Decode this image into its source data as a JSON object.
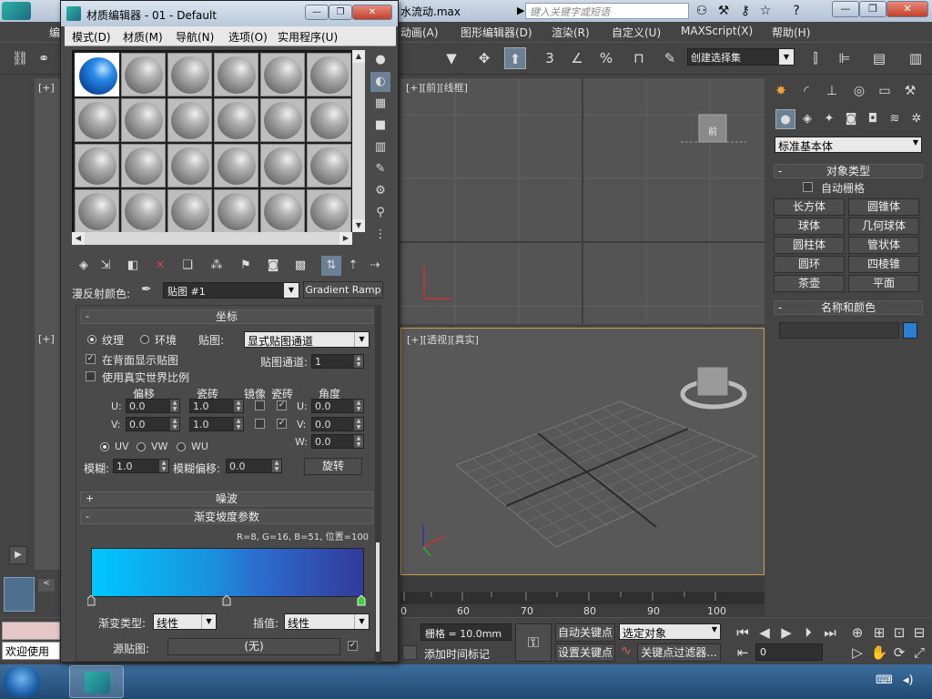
{
  "app": {
    "window_title": "水流动.max",
    "search_placeholder": "键入关键字或短语",
    "menus": [
      "编",
      "动画(A)",
      "图形编辑器(D)",
      "渲染(R)",
      "自定义(U)",
      "MAXScript(X)",
      "帮助(H)"
    ],
    "selection_set": "创建选择集",
    "viewports": {
      "top_label": "[+][前][线框]",
      "persp_label": "[+][透视][真实]",
      "left_top_label": "[+]",
      "left_bottom_label": "[+]"
    },
    "command_panel": {
      "category": "标准基本体",
      "object_type_header": "对象类型",
      "autogrid_label": "自动栅格",
      "buttons": [
        "长方体",
        "圆锥体",
        "球体",
        "几何球体",
        "圆柱体",
        "管状体",
        "圆环",
        "四棱锥",
        "茶壶",
        "平面"
      ],
      "name_color_header": "名称和颜色",
      "object_color": "#2a7fd4"
    },
    "timeline": {
      "ticks": [
        "60",
        "70",
        "80",
        "90",
        "100"
      ],
      "first_tick": "0"
    },
    "statusbar": {
      "welcome": "欢迎使用",
      "grid": "栅格 = 10.0mm",
      "add_time_tag": "添加时间标记",
      "auto_key": "自动关键点",
      "set_key": "设置关键点",
      "selected_objects": "选定对象",
      "key_filters": "关键点过滤器...",
      "frame_value": "0"
    },
    "view_cube_label": "前"
  },
  "material_editor": {
    "title": "材质编辑器 - 01 - Default",
    "menus": [
      "模式(D)",
      "材质(M)",
      "导航(N)",
      "选项(O)",
      "实用程序(U)"
    ],
    "slot_rows": 4,
    "slot_cols": 6,
    "active_slot": 0,
    "diffuse_label": "漫反射颜色:",
    "map_name": "贴图 #1",
    "map_type": "Gradient Ramp",
    "coordinates": {
      "header": "坐标",
      "texture_label": "纹理",
      "environ_label": "环境",
      "mapping_label": "贴图:",
      "mapping_value": "显式贴图通道",
      "show_back_label": "在背面显示贴图",
      "real_world_label": "使用真实世界比例",
      "map_channel_label": "贴图通道:",
      "map_channel_value": "1",
      "offset_label": "偏移",
      "tiling_label": "瓷砖",
      "mirror_label": "镜像",
      "tile_label": "瓷砖",
      "angle_label": "角度",
      "u_label": "U:",
      "v_label": "V:",
      "w_label": "W:",
      "u_offset": "0.0",
      "v_offset": "0.0",
      "u_tiling": "1.0",
      "v_tiling": "1.0",
      "u_angle": "0.0",
      "v_angle": "0.0",
      "w_angle": "0.0",
      "uv_label": "UV",
      "vw_label": "VW",
      "wu_label": "WU",
      "blur_label": "模糊:",
      "blur_value": "1.0",
      "blur_offset_label": "模糊偏移:",
      "blur_offset_value": "0.0",
      "rotate_label": "旋转"
    },
    "noise_header": "噪波",
    "gradient_ramp": {
      "header": "渐变坡度参数",
      "readout": "R=8, G=16, B=51, 位置=100",
      "gradient_type_label": "渐变类型:",
      "gradient_type": "线性",
      "interp_label": "插值:",
      "interp": "线性",
      "source_map_label": "源贴图:",
      "source_map_value": "(无)",
      "color_start": "#00c8ff",
      "color_end": "#333a9a"
    }
  }
}
